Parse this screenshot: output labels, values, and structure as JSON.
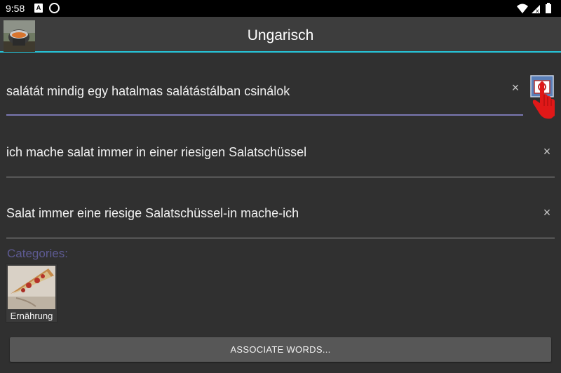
{
  "status_bar": {
    "time": "9:58",
    "notification_icon_letter": "A",
    "icons": [
      "a-notification-icon",
      "sync-icon",
      "wifi-icon",
      "signal-icon",
      "battery-icon"
    ]
  },
  "app_bar": {
    "title": "Ungarisch",
    "thumbnail": "cooking-pot-thumbnail"
  },
  "fields": [
    {
      "text": "salátát mindig egy hatalmas salátástálban csinálok",
      "focused": true
    },
    {
      "text": "ich mache salat immer in einer riesigen Salatschüssel",
      "focused": false
    },
    {
      "text": "Salat immer eine riesige Salatschüssel-in mache-ich",
      "focused": false
    }
  ],
  "clear_glyph": "×",
  "categories": {
    "label": "Categories:",
    "items": [
      {
        "label": "Ernährung",
        "image": "pizza-slice-image"
      }
    ]
  },
  "associate_button": {
    "label": "ASSOCIATE WORDS..."
  },
  "colors": {
    "background": "#303030",
    "app_bar": "#3d3d3d",
    "accent": "#26c6da",
    "focus_underline": "#7a78b2",
    "categories_label": "#5d5a92",
    "button": "#575757"
  }
}
